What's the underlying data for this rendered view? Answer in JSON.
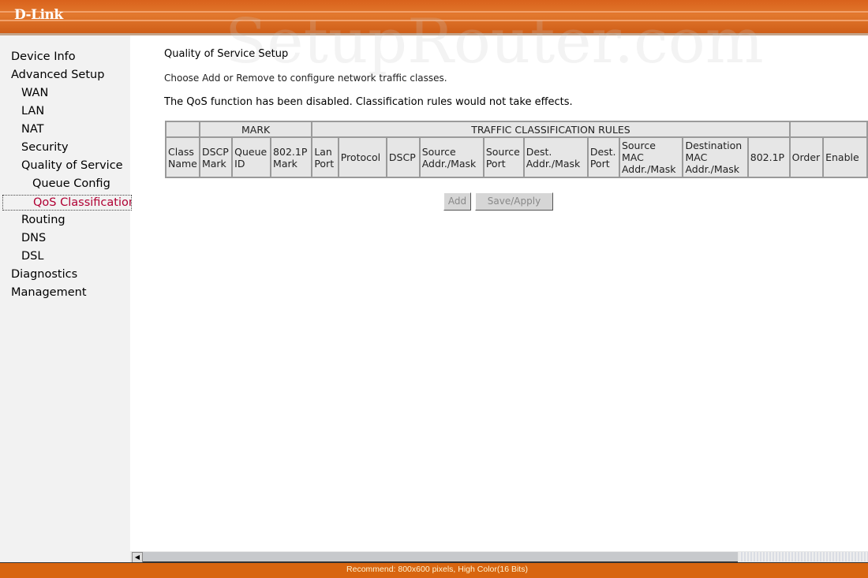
{
  "brand": {
    "logo": "D-Link",
    "watermark": "SetupRouter.com",
    "accent": "#d9621c"
  },
  "sidebar": {
    "items": [
      {
        "label": "Device Info",
        "level": 1
      },
      {
        "label": "Advanced Setup",
        "level": 1
      },
      {
        "label": "WAN",
        "level": 2
      },
      {
        "label": "LAN",
        "level": 2
      },
      {
        "label": "NAT",
        "level": 2
      },
      {
        "label": "Security",
        "level": 2
      },
      {
        "label": "Quality of Service",
        "level": 2
      },
      {
        "label": "Queue Config",
        "level": 3
      },
      {
        "label": "QoS Classification",
        "level": 3,
        "active": true
      },
      {
        "label": "Routing",
        "level": 2
      },
      {
        "label": "DNS",
        "level": 2
      },
      {
        "label": "DSL",
        "level": 2
      },
      {
        "label": "Diagnostics",
        "level": 1
      },
      {
        "label": "Management",
        "level": 1
      }
    ]
  },
  "main": {
    "title": "Quality of Service Setup",
    "description": "Choose Add or Remove to configure network traffic classes.",
    "warning": "The QoS function has been disabled. Classification rules would not take effects.",
    "table": {
      "group_headers": [
        "",
        "MARK",
        "TRAFFIC CLASSIFICATION RULES",
        ""
      ],
      "columns": [
        "Class Name",
        "DSCP Mark",
        "Queue ID",
        "802.1P Mark",
        "Lan Port",
        "Protocol",
        "DSCP",
        "Source Addr./Mask",
        "Source Port",
        "Dest. Addr./Mask",
        "Dest. Port",
        "Source MAC Addr./Mask",
        "Destination MAC Addr./Mask",
        "802.1P",
        "Order",
        "Enable"
      ],
      "rows": []
    },
    "buttons": {
      "add": "Add",
      "save_apply": "Save/Apply"
    }
  },
  "footer": {
    "text": "Recommend: 800x600 pixels, High Color(16 Bits)"
  }
}
